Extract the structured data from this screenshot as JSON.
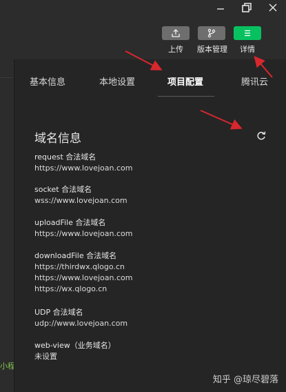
{
  "window": {
    "minimize_icon": "minimize-icon",
    "maximize_icon": "restore-icon",
    "close_icon": "close-icon"
  },
  "toolbar": {
    "upload_label": "上传",
    "version_label": "版本管理",
    "details_label": "详情",
    "details_color": "#07c160"
  },
  "sidebar": {
    "fragment": "小程"
  },
  "tabs": [
    {
      "label": "基本信息"
    },
    {
      "label": "本地设置"
    },
    {
      "label": "项目配置"
    },
    {
      "label": "腾讯云"
    }
  ],
  "section": {
    "title": "域名信息"
  },
  "domains": [
    {
      "label": "request 合法域名",
      "values": [
        "https://www.lovejoan.com"
      ]
    },
    {
      "label": "socket 合法域名",
      "values": [
        "wss://www.lovejoan.com"
      ]
    },
    {
      "label": "uploadFile 合法域名",
      "values": [
        "https://www.lovejoan.com"
      ]
    },
    {
      "label": "downloadFile 合法域名",
      "values": [
        "https://thirdwx.qlogo.cn",
        "https://www.lovejoan.com",
        "https://wx.qlogo.cn"
      ]
    },
    {
      "label": "UDP 合法域名",
      "values": [
        "udp://www.lovejoan.com"
      ]
    },
    {
      "label": "web-view（业务域名）",
      "values": [
        "未设置"
      ]
    }
  ],
  "watermark": "知乎 @琼尽碧落"
}
